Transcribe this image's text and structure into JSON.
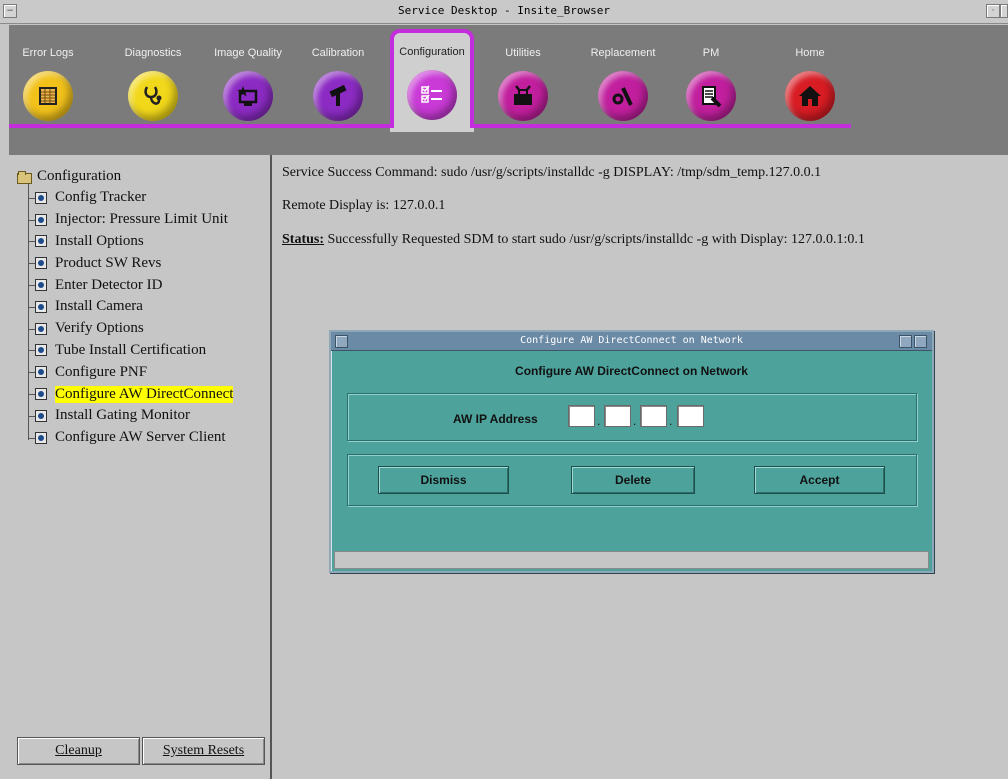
{
  "window": {
    "title": "Service Desktop - Insite_Browser"
  },
  "toolbar": {
    "items": [
      {
        "label": "Error Logs",
        "icon": "error-logs-icon",
        "color": "#f2c21a"
      },
      {
        "label": "Diagnostics",
        "icon": "stethoscope-icon",
        "color": "#f2d81a"
      },
      {
        "label": "Image Quality",
        "icon": "image-quality-icon",
        "color": "#8c2bc4"
      },
      {
        "label": "Calibration",
        "icon": "calibration-icon",
        "color": "#8c2bc4"
      },
      {
        "label": "Configuration",
        "icon": "checklist-icon",
        "color": "#c93ad6",
        "active": true
      },
      {
        "label": "Utilities",
        "icon": "toolbox-icon",
        "color": "#c21f9e"
      },
      {
        "label": "Replacement",
        "icon": "wrench-icon",
        "color": "#c21f9e"
      },
      {
        "label": "PM",
        "icon": "pm-icon",
        "color": "#c21f9e"
      },
      {
        "label": "Home",
        "icon": "home-icon",
        "color": "#d81c24"
      }
    ],
    "accent": "#c32ddc"
  },
  "tree": {
    "root": "Configuration",
    "items": [
      "Config Tracker",
      "Injector: Pressure Limit Unit",
      "Install Options",
      "Product SW Revs",
      "Enter Detector ID",
      "Install Camera",
      "Verify Options",
      "Tube Install Certification",
      "Configure PNF",
      "Configure AW DirectConnect",
      "Install Gating Monitor",
      "Configure AW Server Client"
    ],
    "selected": "Configure AW DirectConnect"
  },
  "left_buttons": {
    "cleanup": "Cleanup",
    "system_resets": "System Resets"
  },
  "main": {
    "command_line": "Service Success Command: sudo /usr/g/scripts/installdc -g DISPLAY: /tmp/sdm_temp.127.0.0.1",
    "remote_display": "Remote Display is: 127.0.0.1",
    "status_label": "Status:",
    "status_text": " Successfully Requested SDM to start sudo /usr/g/scripts/installdc -g with Display: 127.0.0.1:0.1"
  },
  "dialog": {
    "title": "Configure AW DirectConnect on Network",
    "heading": "Configure AW DirectConnect on Network",
    "ip_label": "AW IP Address",
    "ip_octets": [
      "",
      "",
      "",
      ""
    ],
    "buttons": {
      "dismiss": "Dismiss",
      "delete": "Delete",
      "accept": "Accept"
    },
    "bg_color": "#4da29c"
  }
}
